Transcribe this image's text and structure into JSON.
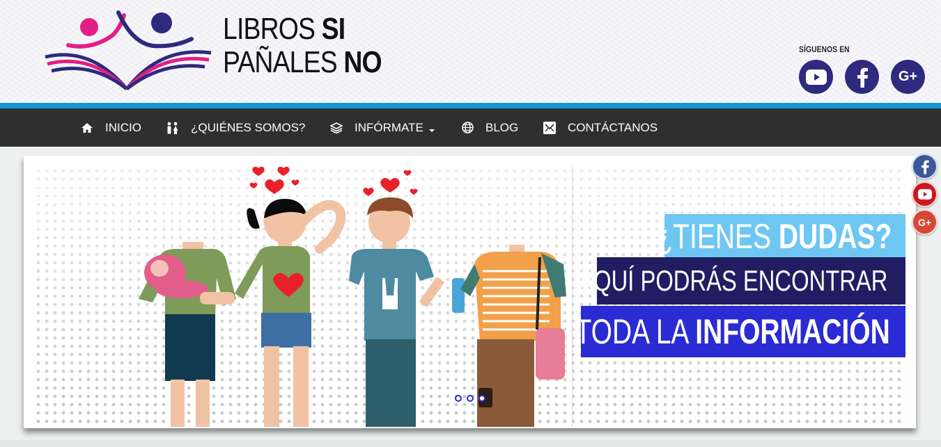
{
  "header": {
    "brand_line1_thin": "LIBROS",
    "brand_line1_bold": "SI",
    "brand_line2_thin": "PAÑALES",
    "brand_line2_bold": "NO",
    "follow_label": "SÍGUENOS EN",
    "social": [
      "youtube-icon",
      "facebook-icon",
      "google-plus-icon"
    ],
    "gplus_text": "G+",
    "social_color": "#2e2a7d"
  },
  "nav": {
    "items": [
      {
        "label": "INICIO",
        "icon": "home-icon"
      },
      {
        "label": "¿QUIÉNES SOMOS?",
        "icon": "people-icon"
      },
      {
        "label": "INFÓRMATE",
        "icon": "layers-icon",
        "dropdown": true
      },
      {
        "label": "BLOG",
        "icon": "globe-icon"
      },
      {
        "label": "CONTÁCTANOS",
        "icon": "envelope-icon"
      }
    ],
    "background": "#2f2f2f",
    "accent_strip": "#1596d8"
  },
  "slider": {
    "line1_thin": "¿TIENES",
    "line1_bold": "DUDAS?",
    "line2": "AQUÍ PODRÁS ENCONTRAR",
    "line3_thin": "TODA LA",
    "line3_bold": "INFORMACIÓN",
    "slide_count": 3,
    "colors": {
      "light_blue": "#6ec6f2",
      "navy": "#221c62",
      "blue": "#2b2bd4"
    }
  },
  "floating_social": {
    "items": [
      "facebook-icon",
      "youtube-icon",
      "google-plus-icon"
    ],
    "gplus_text": "G+"
  }
}
